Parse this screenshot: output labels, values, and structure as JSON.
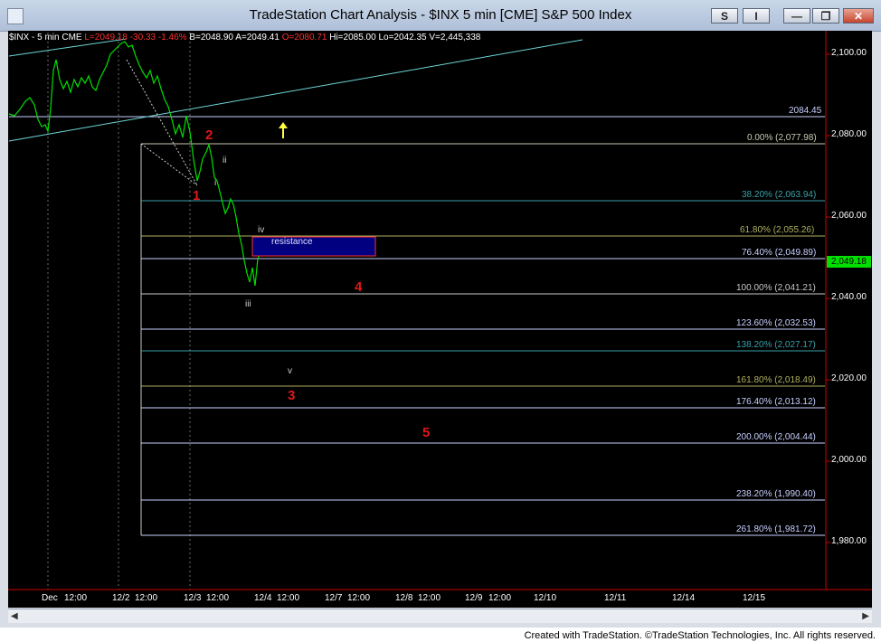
{
  "window": {
    "title": "TradeStation Chart Analysis - $INX 5 min [CME] S&P 500 Index",
    "buttons": {
      "s": "S",
      "i": "I",
      "min": "—",
      "max": "❐",
      "close": "✕"
    }
  },
  "status": {
    "symbol": "$INX - 5 min",
    "exchange": "CME",
    "last": "L=2049.18",
    "change": "-30.33",
    "pct": "-1.46%",
    "bid": "B=2048.90",
    "ask": "A=2049.41",
    "open": "O=2080.71",
    "high": "Hi=2085.00",
    "low": "Lo=2042.35",
    "volume": "V=2,445,338"
  },
  "price_axis": {
    "ticks": [
      "2,100.00",
      "2,080.00",
      "2,060.00",
      "2,040.00",
      "2,020.00",
      "2,000.00",
      "1,980.00"
    ],
    "last_price": "2,049.18",
    "last_price_color": "#00e000"
  },
  "date_axis": {
    "ticks": [
      "Dec",
      "12:00",
      "12/2",
      "12:00",
      "12/3",
      "12:00",
      "12/4",
      "12:00",
      "12/7",
      "12:00",
      "12/8",
      "12:00",
      "12/9",
      "12:00",
      "12/10",
      "12/11",
      "12/14",
      "12/15"
    ]
  },
  "levels": {
    "resistance_line": "2084.45",
    "fib": [
      {
        "label": "0.00% (2,077.98)",
        "color": "#c8c8b4"
      },
      {
        "label": "38.20% (2,063.94)",
        "color": "#3aa0a8"
      },
      {
        "label": "61.80% (2,055.26)",
        "color": "#b0b060"
      },
      {
        "label": "76.40% (2,049.89)",
        "color": "#c8d0ff"
      },
      {
        "label": "100.00% (2,041.21)",
        "color": "#c8c8c8"
      },
      {
        "label": "123.60% (2,032.53)",
        "color": "#c8d0ff"
      },
      {
        "label": "138.20% (2,027.17)",
        "color": "#3aa0a8"
      },
      {
        "label": "161.80% (2,018.49)",
        "color": "#b0b060"
      },
      {
        "label": "176.40% (2,013.12)",
        "color": "#c8d0ff"
      },
      {
        "label": "200.00% (2,004.44)",
        "color": "#c8d0ff"
      },
      {
        "label": "238.20% (1,990.40)",
        "color": "#c8d0ff"
      },
      {
        "label": "261.80% (1,981.72)",
        "color": "#c8d0ff"
      }
    ]
  },
  "annotations": {
    "resistance_box": "resistance",
    "waves_red": [
      "1",
      "2",
      "3",
      "4",
      "5"
    ],
    "waves_small": [
      "i",
      "ii",
      "iii",
      "iv",
      "v"
    ],
    "up_arrow": "↑"
  },
  "footer": "Created with TradeStation. ©TradeStation Technologies, Inc. All rights reserved."
}
